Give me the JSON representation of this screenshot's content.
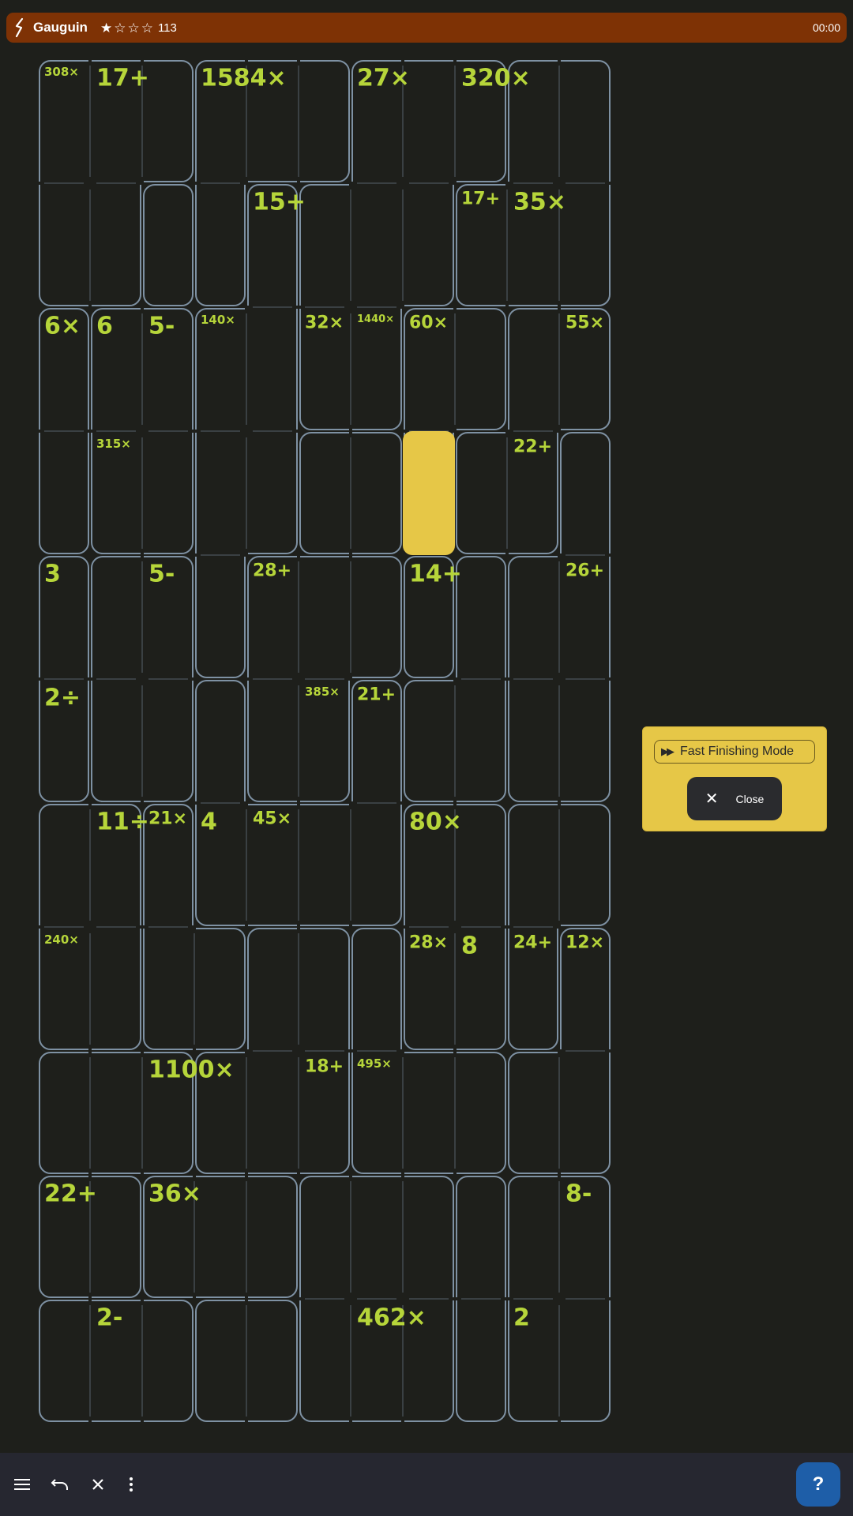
{
  "header": {
    "title": "Gauguin",
    "rating_filled": 1,
    "rating_total": 4,
    "count": "113",
    "timer": "00:00"
  },
  "board": {
    "cols": 11,
    "rows": 11,
    "selected_cell": {
      "row": 3,
      "col": 7
    },
    "colors": {
      "cage": "#7e91a3",
      "label": "#b6d53a",
      "highlight": "#e6c747"
    },
    "regions": [
      "AAABBBCCCDD",
      "AAEBFCCCDDD",
      "GHHFFCCIIJJ",
      "GHHFFKKIJJL",
      "MNNFOOOPQLL",
      "MNNROORQQLL",
      "SSTRRRRUUVV",
      "SSTTWWXUUVY",
      "ZZZWWWXXXYY",
      "aabbbcccdee",
      "fffggcccdee"
    ],
    "cages": [
      {
        "r": 0,
        "c": 0,
        "label": "308×",
        "size": "s"
      },
      {
        "r": 0,
        "c": 1,
        "label": "17+",
        "size": "l"
      },
      {
        "r": 0,
        "c": 3,
        "label": "1584×",
        "size": "l"
      },
      {
        "r": 0,
        "c": 6,
        "label": "27×",
        "size": "l"
      },
      {
        "r": 0,
        "c": 8,
        "label": "320×",
        "size": "l"
      },
      {
        "r": 1,
        "c": 4,
        "label": "15+",
        "size": "l"
      },
      {
        "r": 1,
        "c": 8,
        "label": "17+",
        "size": "m"
      },
      {
        "r": 1,
        "c": 9,
        "label": "35×",
        "size": "l"
      },
      {
        "r": 2,
        "c": 0,
        "label": "6×",
        "size": "l"
      },
      {
        "r": 2,
        "c": 1,
        "label": "6",
        "size": "l"
      },
      {
        "r": 2,
        "c": 2,
        "label": "5-",
        "size": "l"
      },
      {
        "r": 2,
        "c": 3,
        "label": "140×",
        "size": "s"
      },
      {
        "r": 2,
        "c": 5,
        "label": "32×",
        "size": "m"
      },
      {
        "r": 2,
        "c": 6,
        "label": "1440×",
        "size": "xs"
      },
      {
        "r": 2,
        "c": 7,
        "label": "60×",
        "size": "m"
      },
      {
        "r": 2,
        "c": 10,
        "label": "55×",
        "size": "m"
      },
      {
        "r": 3,
        "c": 1,
        "label": "315×",
        "size": "s"
      },
      {
        "r": 3,
        "c": 9,
        "label": "22+",
        "size": "m"
      },
      {
        "r": 4,
        "c": 0,
        "label": "3",
        "size": "l"
      },
      {
        "r": 4,
        "c": 2,
        "label": "5-",
        "size": "l"
      },
      {
        "r": 4,
        "c": 4,
        "label": "28+",
        "size": "m"
      },
      {
        "r": 4,
        "c": 7,
        "label": "14+",
        "size": "l"
      },
      {
        "r": 4,
        "c": 10,
        "label": "26+",
        "size": "m"
      },
      {
        "r": 5,
        "c": 0,
        "label": "2÷",
        "size": "l"
      },
      {
        "r": 5,
        "c": 5,
        "label": "385×",
        "size": "s"
      },
      {
        "r": 5,
        "c": 6,
        "label": "21+",
        "size": "m"
      },
      {
        "r": 6,
        "c": 1,
        "label": "11÷",
        "size": "l"
      },
      {
        "r": 6,
        "c": 2,
        "label": "21×",
        "size": "m"
      },
      {
        "r": 6,
        "c": 3,
        "label": "4",
        "size": "l"
      },
      {
        "r": 6,
        "c": 4,
        "label": "45×",
        "size": "m"
      },
      {
        "r": 6,
        "c": 7,
        "label": "80×",
        "size": "l"
      },
      {
        "r": 7,
        "c": 0,
        "label": "240×",
        "size": "s"
      },
      {
        "r": 7,
        "c": 7,
        "label": "28×",
        "size": "m"
      },
      {
        "r": 7,
        "c": 8,
        "label": "8",
        "size": "l"
      },
      {
        "r": 7,
        "c": 9,
        "label": "24+",
        "size": "m"
      },
      {
        "r": 7,
        "c": 10,
        "label": "12×",
        "size": "m"
      },
      {
        "r": 8,
        "c": 2,
        "label": "1100×",
        "size": "l"
      },
      {
        "r": 8,
        "c": 5,
        "label": "18+",
        "size": "m"
      },
      {
        "r": 8,
        "c": 6,
        "label": "495×",
        "size": "s"
      },
      {
        "r": 9,
        "c": 0,
        "label": "22+",
        "size": "l"
      },
      {
        "r": 9,
        "c": 2,
        "label": "36×",
        "size": "l"
      },
      {
        "r": 9,
        "c": 10,
        "label": "8-",
        "size": "l"
      },
      {
        "r": 10,
        "c": 1,
        "label": "2-",
        "size": "l"
      },
      {
        "r": 10,
        "c": 6,
        "label": "462×",
        "size": "l"
      },
      {
        "r": 10,
        "c": 9,
        "label": "2",
        "size": "l"
      }
    ]
  },
  "popup": {
    "fast_finishing_label": "Fast Finishing Mode",
    "fast_finishing_icon": "fast-forward-icon",
    "close_label": "Close",
    "close_icon": "close-icon"
  },
  "bottom_bar": {
    "icons": [
      "menu-icon",
      "undo-icon",
      "clear-icon",
      "more-vert-icon"
    ],
    "help_label": "?"
  }
}
